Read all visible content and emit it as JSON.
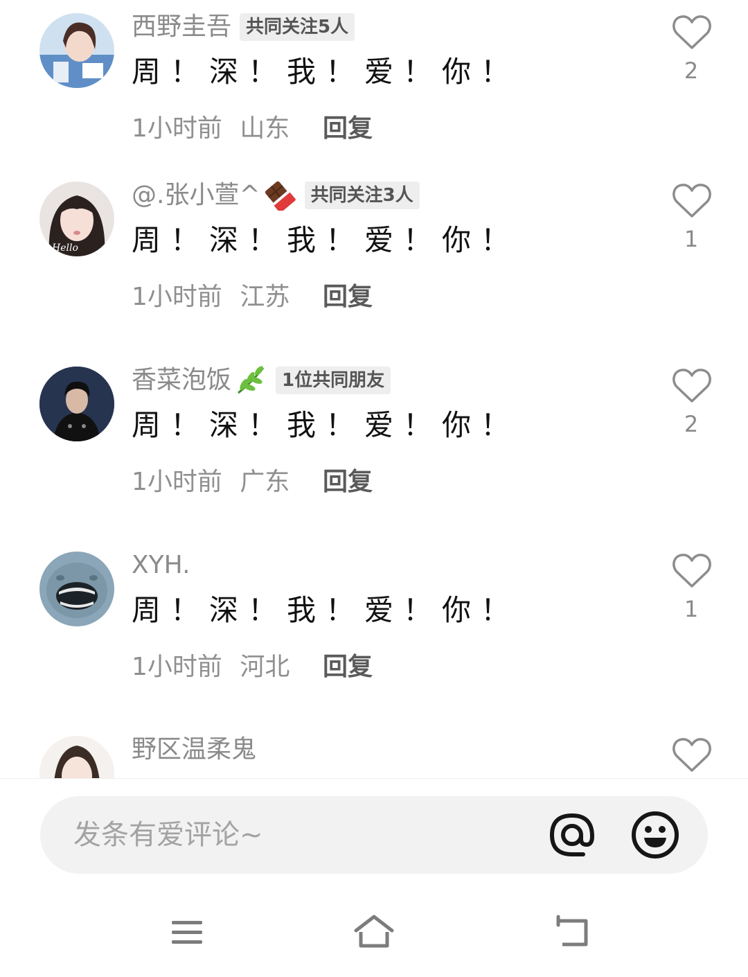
{
  "comments": [
    {
      "username": "西野圭吾",
      "badge": "共同关注5人",
      "text": "周！深！我！爱！你！",
      "time": "1小时前",
      "location": "山东",
      "reply_label": "回复",
      "likes": "2"
    },
    {
      "username": "@.张小萱^",
      "username_emoji": "chocolate-bar-icon",
      "badge": "共同关注3人",
      "text": "周！深！我！爱！你！",
      "time": "1小时前",
      "location": "江苏",
      "reply_label": "回复",
      "likes": "1"
    },
    {
      "username": "香菜泡饭",
      "username_emoji": "herb-icon",
      "badge": "1位共同朋友",
      "text": "周！深！我！爱！你！",
      "time": "1小时前",
      "location": "广东",
      "reply_label": "回复",
      "likes": "2"
    },
    {
      "username": "XYH.",
      "text": "周！深！我！爱！你！",
      "time": "1小时前",
      "location": "河北",
      "reply_label": "回复",
      "likes": "1"
    },
    {
      "username": "野区温柔鬼"
    }
  ],
  "input": {
    "placeholder": "发条有爱评论~",
    "mention_icon": "at-icon",
    "emoji_icon": "smiley-icon"
  },
  "navbar": {
    "icons": [
      "menu-icon",
      "home-icon",
      "back-icon"
    ]
  }
}
